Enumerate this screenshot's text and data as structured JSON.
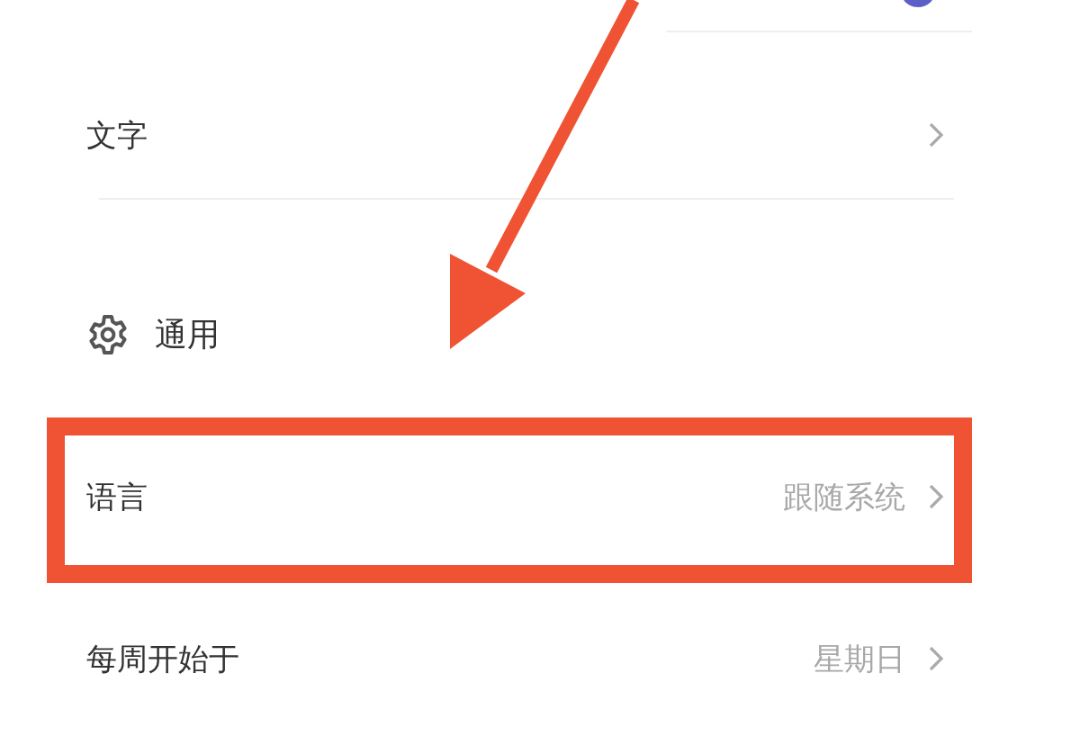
{
  "settings": [
    {
      "kind": "row",
      "label": "文字",
      "highlighted": false
    },
    {
      "kind": "section",
      "label": "通用"
    },
    {
      "kind": "row",
      "label": "语言",
      "value": "跟随系统",
      "highlighted": true
    },
    {
      "kind": "row",
      "label": "每周开始于",
      "value": "星期日",
      "highlighted": false
    }
  ]
}
